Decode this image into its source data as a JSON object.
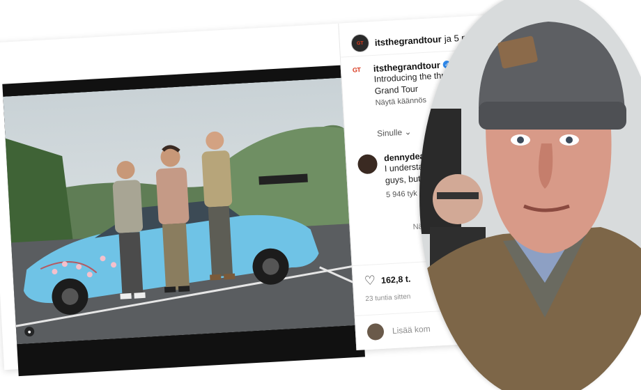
{
  "post": {
    "header_user": "itsthegrandtour",
    "header_rest": "ja 5 muuta",
    "avatar_text": "GT",
    "caption_user": "itsthegrandtour",
    "caption_time": "23",
    "caption_text_line1": "Introducing the thre",
    "caption_text_line2": "Grand Tour",
    "see_translation": "Näytä käännös",
    "sort_label": "Sinulle",
    "comment_user": "dennydea",
    "comment_text_line1": "I understa",
    "comment_text_line2": "guys, but",
    "comment_likes": "5 946 tyk",
    "comment_more": "Nä",
    "post_likes": "162,8 t.",
    "posted_ago": "23 tuntia sitten",
    "add_comment": "Lisää kom"
  },
  "colors": {
    "accent_red": "#d9381e",
    "verified_blue": "#2f8bf0",
    "car_blue": "#6fc3e6"
  },
  "icons": [
    "heart-icon",
    "person-tag-icon",
    "chevron-down-icon",
    "verified-icon"
  ]
}
